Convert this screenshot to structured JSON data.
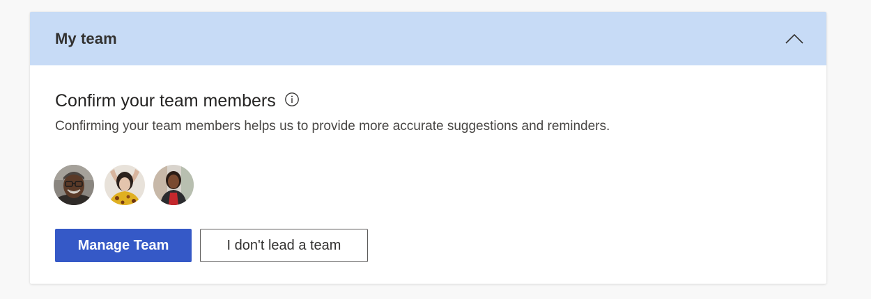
{
  "card": {
    "title": "My team",
    "collapse_icon": "chevron-up-icon"
  },
  "section": {
    "title": "Confirm your team members",
    "info_icon": "info-icon",
    "description": "Confirming your team members helps us to provide more accurate suggestions and reminders."
  },
  "avatars": [
    {
      "name": "team-member-1"
    },
    {
      "name": "team-member-2"
    },
    {
      "name": "team-member-3"
    }
  ],
  "actions": {
    "manage_label": "Manage Team",
    "no_team_label": "I don't lead a team"
  },
  "colors": {
    "header_bg": "#c7dbf6",
    "primary_button": "#3559c7",
    "page_bg": "#f8f8f8"
  }
}
